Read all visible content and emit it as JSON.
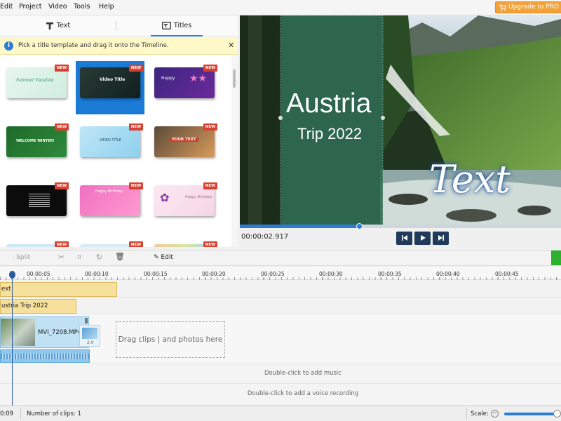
{
  "menu": [
    "Edit",
    "Project",
    "Video",
    "Tools",
    "Help"
  ],
  "upgrade_label": "Upgrade to PRO V",
  "tabs": {
    "text": "Text",
    "titles": "Titles"
  },
  "hint": "Pick a title template and drag it onto the Timeline.",
  "thumbs": [
    {
      "label": "Summer Vacation",
      "badge": "NEW"
    },
    {
      "label": "Video Title",
      "badge": "NEW"
    },
    {
      "label": "Happy",
      "badge": "NEW"
    },
    {
      "label": "WELCOME WINTER!",
      "badge": "NEW"
    },
    {
      "label": "VIDEO TITLE",
      "badge": "NEW"
    },
    {
      "label": "YOUR TEXT",
      "badge": "NEW"
    },
    {
      "label": "",
      "badge": "NEW"
    },
    {
      "label": "Happy Birthday",
      "badge": "NEW"
    },
    {
      "label": "Happy Birthday",
      "badge": "NEW"
    },
    {
      "label": "",
      "badge": "NEW"
    },
    {
      "label": "",
      "badge": "NEW"
    },
    {
      "label": "",
      "badge": "NEW"
    }
  ],
  "preview": {
    "title": "Austria",
    "subtitle": "Trip 2022",
    "overlay_text": "Text",
    "timecode": "00:00:02.917",
    "progress": 0.37
  },
  "toolbar": {
    "split": "Split",
    "edit": "Edit"
  },
  "ruler": [
    "00:00:05",
    "00:00:10",
    "00:00:15",
    "00:00:20",
    "00:00:25",
    "00:00:30",
    "00:00:35",
    "00:00:40",
    "00:00:45"
  ],
  "tracks": {
    "text_clip": "ext",
    "title_clip": "ustria  Trip 2022",
    "video_clip": "MVI_7208.MP4",
    "transition_value": "2.0",
    "dropzone": "Drag clips | and photos here",
    "music_hint": "Double-click to add music",
    "voice_hint": "Double-click to add a voice recording"
  },
  "status": {
    "time": "0:09",
    "clips": "Number of clips: 1",
    "scale_label": "Scale:"
  },
  "colors": {
    "accent": "#2b7dd3",
    "upgrade": "#f3a23a",
    "new_badge": "#d8412f",
    "title_clip": "#f6e09b"
  }
}
